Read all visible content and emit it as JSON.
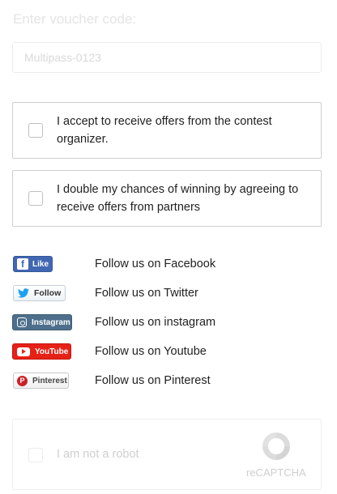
{
  "voucher": {
    "label": "Enter voucher code:",
    "placeholder": "Multipass-0123"
  },
  "consents": [
    {
      "text": "I accept to receive offers from the contest organizer."
    },
    {
      "text": "I double my chances of winning by agreeing to receive offers from partners"
    }
  ],
  "social": [
    {
      "badge": "Like",
      "icon": "facebook-icon",
      "label": "Follow us on Facebook",
      "color": "#4267b2"
    },
    {
      "badge": "Follow",
      "icon": "twitter-icon",
      "label": "Follow us on Twitter",
      "color": "#1da1f2"
    },
    {
      "badge": "Instagram",
      "icon": "instagram-icon",
      "label": "Follow us on instagram",
      "color": "#4d6f8c"
    },
    {
      "badge": "YouTube",
      "icon": "youtube-icon",
      "label": "Follow us on Youtube",
      "color": "#e62117"
    },
    {
      "badge": "Pinterest",
      "icon": "pinterest-icon",
      "label": "Follow us on Pinterest",
      "color": "#cb2027"
    }
  ],
  "recaptcha": {
    "label": "I am not a robot",
    "brand": "reCAPTCHA"
  }
}
